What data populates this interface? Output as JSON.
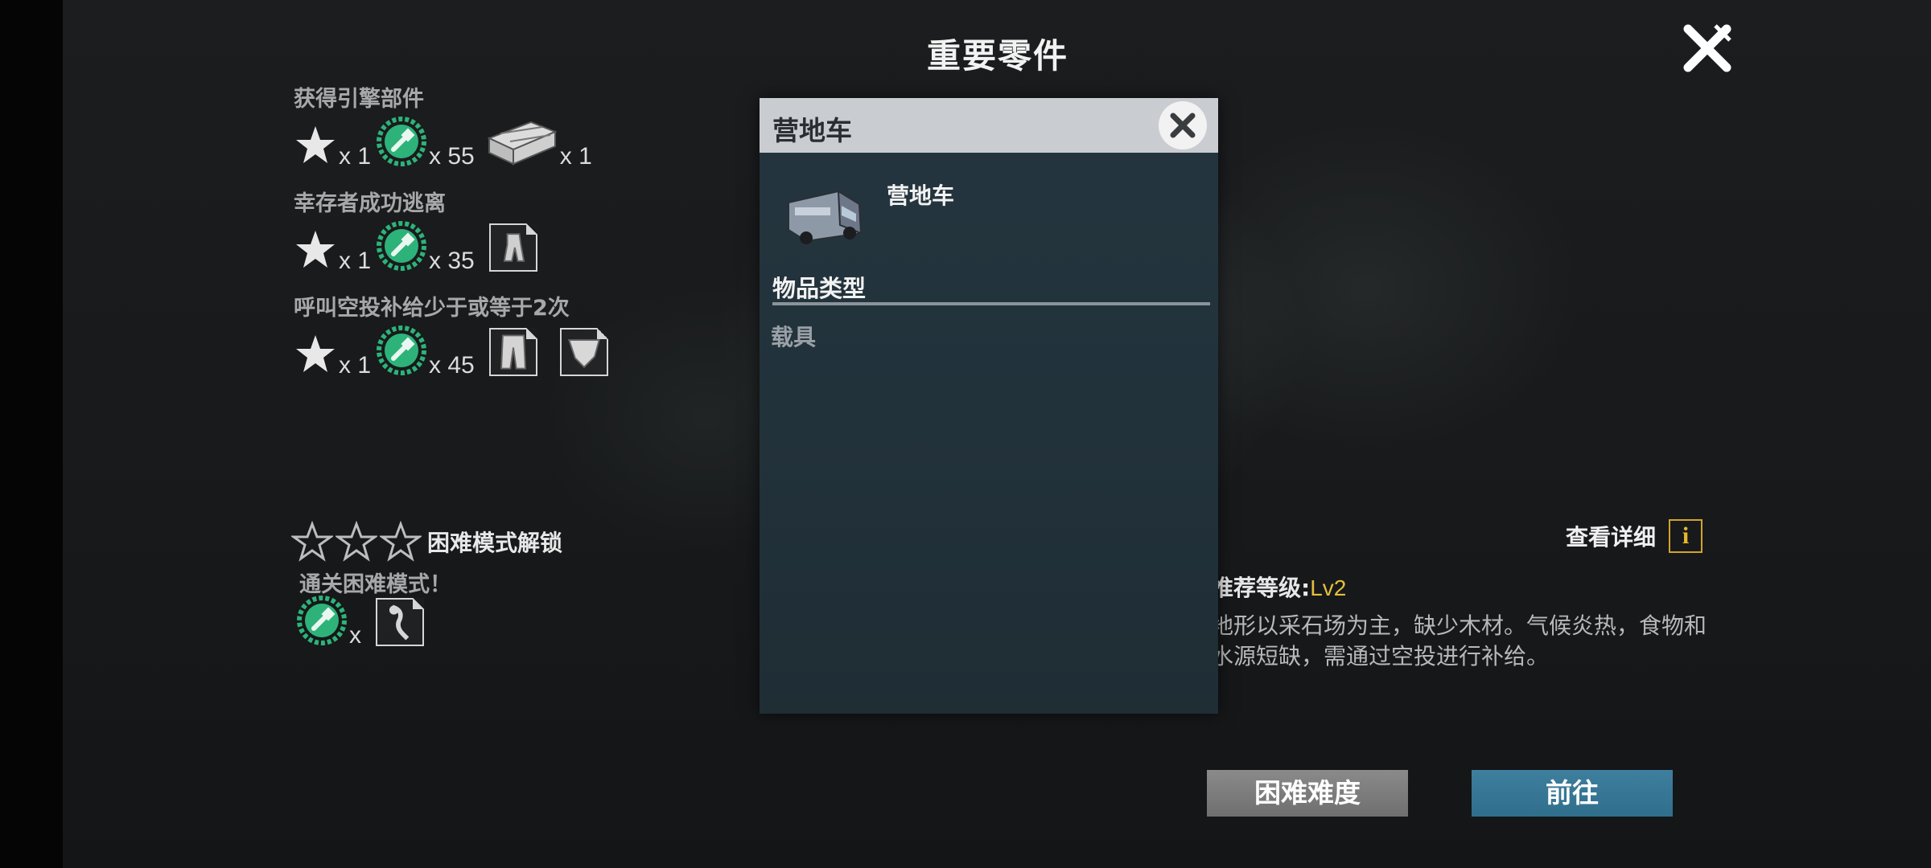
{
  "title": "重要零件",
  "tasks": [
    {
      "label": "获得引擎部件",
      "star_count": "x 1",
      "parts_count": "x 55",
      "extra_count": "x 1"
    },
    {
      "label": "幸存者成功逃离",
      "star_count": "x 1",
      "parts_count": "x 35"
    },
    {
      "label": "呼叫空投补给少于或等于2次",
      "star_count": "x 1",
      "parts_count": "x 45"
    }
  ],
  "hard_mode": {
    "stars": 3,
    "label": "困难模式解锁",
    "desc": "通关困难模式！",
    "parts_count": "x"
  },
  "details": {
    "label": "查看详细",
    "icon": "i"
  },
  "recommend": {
    "label": "推荐等级:",
    "value": "Lv2"
  },
  "description": "地形以采石场为主，缺少木材。气候炎热，食物和水源短缺，需通过空投进行补给。",
  "buttons": {
    "hard": "困难难度",
    "go": "前往"
  },
  "popup": {
    "title": "营地车",
    "item_name": "营地车",
    "type_label": "物品类型",
    "type_value": "载具"
  },
  "colors": {
    "accent_gear": "#2db37a",
    "go_button": "#35768f",
    "level": "#e3c03a"
  }
}
